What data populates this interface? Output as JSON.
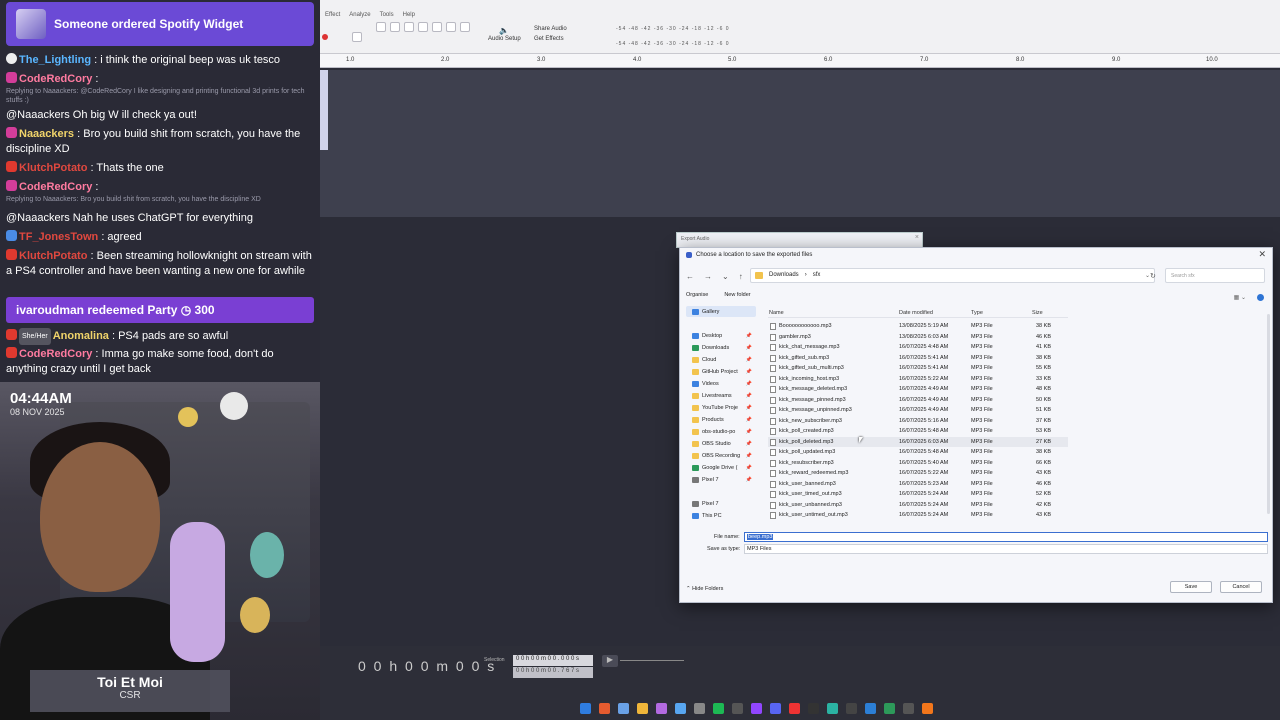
{
  "overlay": {
    "alert": "Someone ordered Spotify Widget",
    "clock_time": "04:44AM",
    "clock_date": "08 NOV 2025",
    "redeem": "ivaroudman redeemed Party ◷ 300",
    "now_playing": {
      "title": "Toi Et Moi",
      "artist": "CSR"
    }
  },
  "chat": [
    {
      "user": "The_Lightling",
      "text": ": i think the original beep was uk tesco"
    },
    {
      "user": "CodeRedCory",
      "text": ":",
      "reply": "Replying to Naaackers: @CodeRedCory I like designing and printing functional 3d prints for tech stuffs :)"
    },
    {
      "user": "",
      "text": "@Naaackers Oh big W ill check ya out!"
    },
    {
      "user": "Naaackers",
      "text": ": Bro you build shit from scratch, you have the discipline XD"
    },
    {
      "user": "KlutchPotato",
      "text": ": Thats the one"
    },
    {
      "user": "CodeRedCory",
      "text": ":",
      "reply": "Replying to Naaackers: Bro you build shit from scratch, you have the discipline XD"
    },
    {
      "user": "",
      "text": "@Naaackers Nah he uses ChatGPT for everything"
    },
    {
      "user": "TF_JonesTown",
      "text": ": agreed"
    },
    {
      "user": "KlutchPotato",
      "text": ": Been streaming hollowknight on stream with a PS4 controller and have been wanting a new one for awhile"
    },
    {
      "user": "Anomalina",
      "badge": "She/Her",
      "text": ": PS4 pads are so awful"
    },
    {
      "user": "CodeRedCory",
      "text": ": Imma go make some food, don't do anything crazy until I get back"
    }
  ],
  "app": {
    "menus": [
      "Effect",
      "Analyze",
      "Tools",
      "Help"
    ],
    "share_audio": "Share Audio",
    "get_effects": "Get Effects",
    "audio_setup": "Audio Setup",
    "meter_ticks": "-54 -48 -42 -36 -30 -24 -18 -12 -6 0",
    "ruler": [
      "1.0",
      "2.0",
      "3.0",
      "4.0",
      "5.0",
      "6.0",
      "7.0",
      "8.0",
      "9.0",
      "10.0"
    ],
    "selection_label": "Selection",
    "selection_start": "0 0 h 0 0 m 0 0 . 0 0 0 s",
    "selection_end": "0 0 h 0 0 m 0 0 . 7 6 7 s",
    "time_display": "0 0 h 0 0 m 0 0 s"
  },
  "export_window_title": "Export Audio",
  "dialog": {
    "title": "Choose a location to save the exported files",
    "path": [
      "Downloads",
      "sfx"
    ],
    "search_placeholder": "Search sfx",
    "organise": "Organise",
    "new_folder": "New folder",
    "sidebar": [
      "Gallery",
      "Desktop",
      "Downloads",
      "Cloud",
      "GitHub Project",
      "Videos",
      "Livestreams",
      "YouTube Proje",
      "Products",
      "obs-studio-po",
      "OBS Studio",
      "OBS Recording",
      "Google Drive (",
      "Pixel 7",
      "Pixel 7",
      "This PC"
    ],
    "columns": {
      "name": "Name",
      "date": "Date modified",
      "type": "Type",
      "size": "Size"
    },
    "files": [
      {
        "name": "Boooooooooooo.mp3",
        "date": "13/08/2025 5:19 AM",
        "type": "MP3 File",
        "size": "38 KB"
      },
      {
        "name": "gambler.mp3",
        "date": "13/08/2025 6:03 AM",
        "type": "MP3 File",
        "size": "46 KB"
      },
      {
        "name": "kick_chat_message.mp3",
        "date": "16/07/2025 4:48 AM",
        "type": "MP3 File",
        "size": "41 KB"
      },
      {
        "name": "kick_gifted_sub.mp3",
        "date": "16/07/2025 5:41 AM",
        "type": "MP3 File",
        "size": "38 KB"
      },
      {
        "name": "kick_gifted_sub_multi.mp3",
        "date": "16/07/2025 5:41 AM",
        "type": "MP3 File",
        "size": "55 KB"
      },
      {
        "name": "kick_incoming_host.mp3",
        "date": "16/07/2025 5:22 AM",
        "type": "MP3 File",
        "size": "33 KB"
      },
      {
        "name": "kick_message_deleted.mp3",
        "date": "16/07/2025 4:49 AM",
        "type": "MP3 File",
        "size": "48 KB"
      },
      {
        "name": "kick_message_pinned.mp3",
        "date": "16/07/2025 4:49 AM",
        "type": "MP3 File",
        "size": "50 KB"
      },
      {
        "name": "kick_message_unpinned.mp3",
        "date": "16/07/2025 4:49 AM",
        "type": "MP3 File",
        "size": "51 KB"
      },
      {
        "name": "kick_new_subscriber.mp3",
        "date": "16/07/2025 5:16 AM",
        "type": "MP3 File",
        "size": "37 KB"
      },
      {
        "name": "kick_poll_created.mp3",
        "date": "16/07/2025 5:48 AM",
        "type": "MP3 File",
        "size": "53 KB"
      },
      {
        "name": "kick_poll_deleted.mp3",
        "date": "16/07/2025 6:03 AM",
        "type": "MP3 File",
        "size": "27 KB"
      },
      {
        "name": "kick_poll_updated.mp3",
        "date": "16/07/2025 5:48 AM",
        "type": "MP3 File",
        "size": "38 KB"
      },
      {
        "name": "kick_resubscriber.mp3",
        "date": "16/07/2025 5:40 AM",
        "type": "MP3 File",
        "size": "66 KB"
      },
      {
        "name": "kick_reward_redeemed.mp3",
        "date": "16/07/2025 5:22 AM",
        "type": "MP3 File",
        "size": "43 KB"
      },
      {
        "name": "kick_user_banned.mp3",
        "date": "16/07/2025 5:23 AM",
        "type": "MP3 File",
        "size": "46 KB"
      },
      {
        "name": "kick_user_timed_out.mp3",
        "date": "16/07/2025 5:24 AM",
        "type": "MP3 File",
        "size": "52 KB"
      },
      {
        "name": "kick_user_unbanned.mp3",
        "date": "16/07/2025 5:24 AM",
        "type": "MP3 File",
        "size": "42 KB"
      },
      {
        "name": "kick_user_untimed_out.mp3",
        "date": "16/07/2025 5:24 AM",
        "type": "MP3 File",
        "size": "43 KB"
      }
    ],
    "filename_label": "File name:",
    "filename_value": "beep.mp3",
    "savetype_label": "Save as type:",
    "savetype_value": "MP3 Files",
    "hide_folders": "Hide Folders",
    "save": "Save",
    "cancel": "Cancel"
  }
}
